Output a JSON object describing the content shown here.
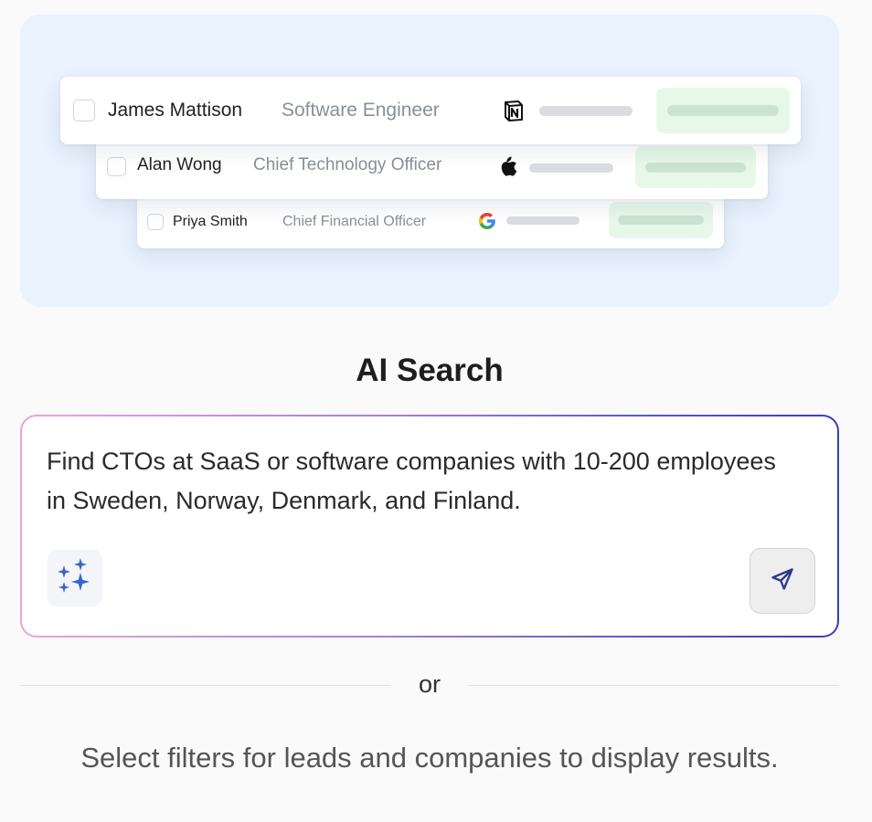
{
  "preview": {
    "leads": [
      {
        "name": "James Mattison",
        "title": "Software Engineer",
        "company_icon": "notion-icon"
      },
      {
        "name": "Alan Wong",
        "title": "Chief Technology Officer",
        "company_icon": "apple-icon"
      },
      {
        "name": "Priya Smith",
        "title": "Chief Financial Officer",
        "company_icon": "google-icon"
      }
    ]
  },
  "ai_search": {
    "heading": "AI Search",
    "query": "Find CTOs at SaaS or software companies with 10-200 employees in Sweden, Norway, Denmark, and Finland.",
    "sparkle_icon": "sparkles-icon",
    "send_icon": "send-icon"
  },
  "separator": {
    "label": "or"
  },
  "hint": {
    "text": "Select filters for leads and companies to display results."
  },
  "colors": {
    "hero_bg": "#e9f2fd",
    "accent": "#3a3fb8",
    "gradient_start": "#e8a6d9",
    "gradient_end": "#3a3fb8",
    "pill_green": "#e7f8e9"
  }
}
